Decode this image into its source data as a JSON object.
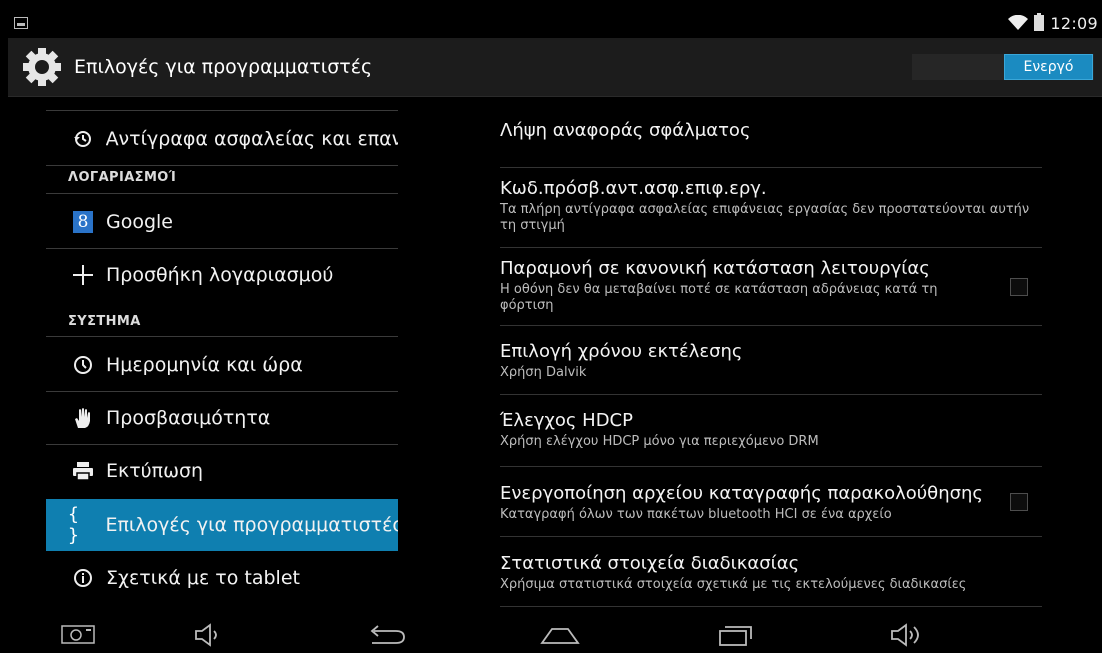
{
  "status_bar": {
    "time": "12:09"
  },
  "action_bar": {
    "title": "Επιλογές για προγραμματιστές",
    "toggle_label": "Ενεργό"
  },
  "left_menu": {
    "items": [
      {
        "label": "Αντίγραφα ασφαλείας και επαν",
        "icon": "restore-icon"
      },
      {
        "section": "ΛΟΓΑΡΙΑΣΜΟΊ"
      },
      {
        "label": "Google",
        "icon": "google-icon"
      },
      {
        "label": "Προσθήκη λογαριασμού",
        "icon": "plus-icon"
      },
      {
        "section": "ΣΥΣΤΗΜΑ"
      },
      {
        "label": "Ημερομηνία και ώρα",
        "icon": "clock-icon"
      },
      {
        "label": "Προσβασιμότητα",
        "icon": "hand-icon"
      },
      {
        "label": "Εκτύπωση",
        "icon": "printer-icon"
      },
      {
        "label": "Επιλογές για προγραμματιστές",
        "icon": "braces-icon",
        "selected": true
      },
      {
        "label": "Σχετικά με το tablet",
        "icon": "info-icon"
      }
    ]
  },
  "settings": [
    {
      "title": "Λήψη αναφοράς σφάλματος"
    },
    {
      "title": "Κωδ.πρόσβ.αντ.ασφ.επιφ.εργ.",
      "summary": "Τα πλήρη αντίγραφα ασφαλείας επιφάνειας εργασίας δεν προστατεύονται αυτήν τη στιγμή"
    },
    {
      "title": "Παραμονή σε κανονική κατάσταση λειτουργίας",
      "summary": "Η οθόνη δεν θα μεταβαίνει ποτέ σε κατάσταση αδράνειας κατά τη φόρτιση",
      "checked": false
    },
    {
      "title": "Επιλογή χρόνου εκτέλεσης",
      "summary": "Χρήση Dalvik"
    },
    {
      "title": "Έλεγχος HDCP",
      "summary": "Χρήση ελέγχου HDCP μόνο για περιεχόμενο DRM"
    },
    {
      "title": "Ενεργοποίηση αρχείου καταγραφής παρακολούθησης",
      "summary": "Καταγραφή όλων των πακέτων bluetooth HCI σε ένα αρχείο",
      "checked": false
    },
    {
      "title": "Στατιστικά στοιχεία διαδικασίας",
      "summary": "Χρήσιμα στατιστικά στοιχεία σχετικά με τις εκτελούμενες διαδικασίες"
    }
  ],
  "colors": {
    "accent": "#0f7fb0",
    "toggle_on": "#1b8bc1",
    "background": "#000000",
    "action_bar": "#1c1c1c"
  }
}
